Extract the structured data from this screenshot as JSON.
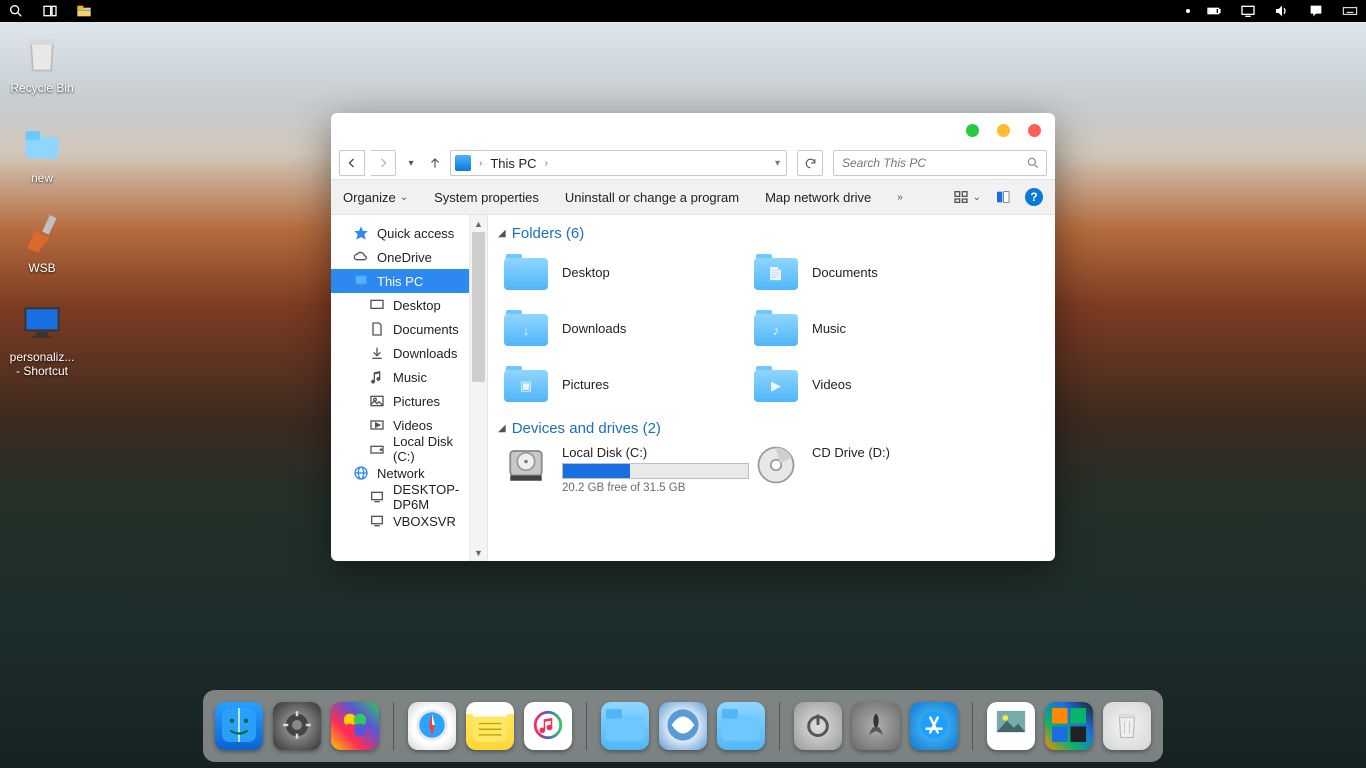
{
  "taskbar": {
    "tray": [
      "battery",
      "monitor",
      "volume",
      "action-center",
      "keyboard"
    ]
  },
  "desktop_icons": [
    {
      "name": "recycle-bin",
      "label": "Recycle Bin",
      "icon": "trash"
    },
    {
      "name": "new-folder",
      "label": "new",
      "icon": "folder"
    },
    {
      "name": "wsb",
      "label": "WSB",
      "icon": "brush"
    },
    {
      "name": "personalize",
      "label": "personaliz...\n- Shortcut",
      "icon": "monitor"
    }
  ],
  "window": {
    "addr_label": "This PC",
    "search_placeholder": "Search This PC",
    "cmd": {
      "organize": "Organize",
      "sys": "System properties",
      "uninstall": "Uninstall or change a program",
      "map": "Map network drive"
    },
    "sidebar": [
      {
        "label": "Quick access",
        "icon": "star",
        "cls": ""
      },
      {
        "label": "OneDrive",
        "icon": "cloud",
        "cls": ""
      },
      {
        "label": "This PC",
        "icon": "pc",
        "cls": "selected"
      },
      {
        "label": "Desktop",
        "icon": "desk",
        "cls": "sub"
      },
      {
        "label": "Documents",
        "icon": "doc",
        "cls": "sub"
      },
      {
        "label": "Downloads",
        "icon": "down",
        "cls": "sub"
      },
      {
        "label": "Music",
        "icon": "music",
        "cls": "sub"
      },
      {
        "label": "Pictures",
        "icon": "pic",
        "cls": "sub"
      },
      {
        "label": "Videos",
        "icon": "vid",
        "cls": "sub"
      },
      {
        "label": "Local Disk (C:)",
        "icon": "disk",
        "cls": "sub"
      },
      {
        "label": "Network",
        "icon": "net",
        "cls": ""
      },
      {
        "label": "DESKTOP-DP6M",
        "icon": "host",
        "cls": "sub"
      },
      {
        "label": "VBOXSVR",
        "icon": "host",
        "cls": "sub"
      }
    ],
    "folders_header": "Folders (6)",
    "folders": [
      {
        "label": "Desktop",
        "glyph": ""
      },
      {
        "label": "Documents",
        "glyph": "📄"
      },
      {
        "label": "Downloads",
        "glyph": "↓"
      },
      {
        "label": "Music",
        "glyph": "♪"
      },
      {
        "label": "Pictures",
        "glyph": "▣"
      },
      {
        "label": "Videos",
        "glyph": "▶"
      }
    ],
    "drives_header": "Devices and drives (2)",
    "drives": [
      {
        "label": "Local Disk (C:)",
        "sub": "20.2 GB free of 31.5 GB",
        "fill": 36,
        "type": "hdd"
      },
      {
        "label": "CD Drive (D:)",
        "sub": "",
        "fill": 0,
        "type": "cd"
      }
    ]
  },
  "dock": [
    "finder",
    "settings",
    "game",
    "sep",
    "safari",
    "notes",
    "itunes",
    "sep",
    "folder",
    "yosemite",
    "folder",
    "sep",
    "power",
    "launch",
    "appstore",
    "sep",
    "photo",
    "grid",
    "trash"
  ]
}
